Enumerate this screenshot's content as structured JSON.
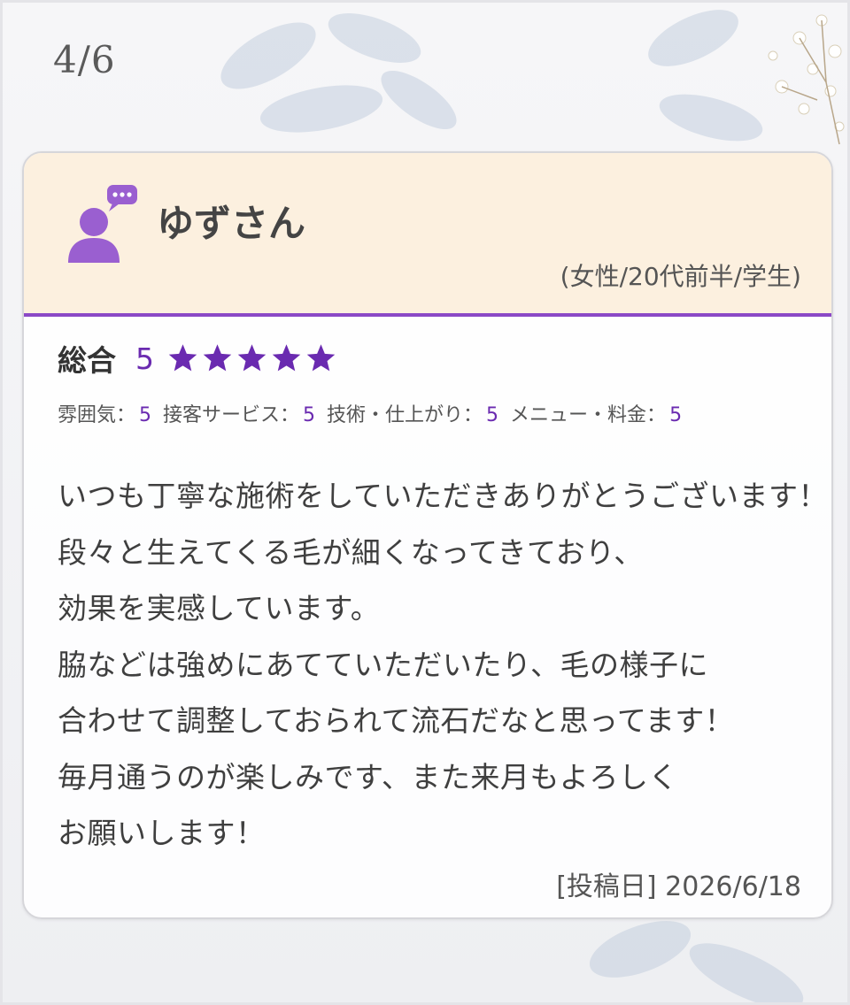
{
  "pager": {
    "counter": "4/6"
  },
  "review": {
    "name": "ゆずさん",
    "meta": "(女性/20代前半/学生)",
    "overall_label": "総合",
    "overall_score": "5",
    "star_count": 5,
    "star_color": "#6a2ab0",
    "sub_ratings": [
      {
        "label": "雰囲気：",
        "value": "5"
      },
      {
        "label": "接客サービス：",
        "value": "5"
      },
      {
        "label": "技術・仕上がり：",
        "value": "5"
      },
      {
        "label": "メニュー・料金：",
        "value": "5"
      }
    ],
    "comment_lines": [
      "いつも丁寧な施術をしていただきありがとうございます！",
      "段々と生えてくる毛が細くなってきており、",
      "効果を実感しています。",
      "脇などは強めにあてていただいたり、毛の様子に",
      "合わせて調整しておられて流石だなと思ってます！",
      "毎月通うのが楽しみです、また来月もよろしく",
      "お願いします！"
    ],
    "posted": "[投稿日] 2026/6/18"
  },
  "colors": {
    "accent": "#8b49c6",
    "header_bg": "#fcf0df",
    "avatar": "#9a5fd0"
  },
  "icons": {
    "avatar": "user-speech-bubble-icon",
    "star": "star-icon"
  }
}
